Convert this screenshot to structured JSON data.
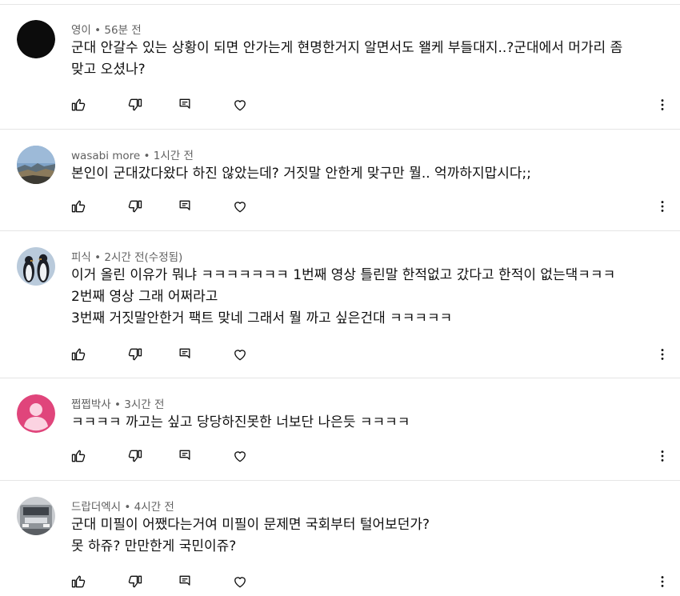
{
  "comments": [
    {
      "author": "영이",
      "time": "56분 전",
      "lines": [
        "군대 안갈수 있는 상황이 되면 안가는게 현명한거지 알면서도 왤케 부들대지..?군대에서 머가리 좀",
        "맞고 오셨나?"
      ],
      "avatar": "black-circle"
    },
    {
      "author": "wasabi more",
      "time": "1시간 전",
      "lines": [
        "본인이 군대갔다왔다 하진 않았는데? 거짓말 안한게 맞구만 뭘.. 억까하지맙시다;;"
      ],
      "avatar": "landscape-photo"
    },
    {
      "author": "피식",
      "time": "2시간 전(수정됨)",
      "lines": [
        "이거 올린 이유가 뭐냐 ㅋㅋㅋㅋㅋㅋㅋ 1번째 영상 틀린말 한적없고 갔다고 한적이 없는댁ㅋㅋㅋ",
        "2번째 영상 그래 어쩌라고",
        "3번째 거짓말안한거 팩트 맞네 그래서 뭘 까고 싶은건대 ㅋㅋㅋㅋㅋ"
      ],
      "avatar": "penguin-photo"
    },
    {
      "author": "쩝쩝박사",
      "time": "3시간 전",
      "lines": [
        "ㅋㅋㅋㅋ 까고는 싶고 당당하진못한 너보단 나은듯 ㅋㅋㅋㅋ"
      ],
      "avatar": "default-person-pink"
    },
    {
      "author": "드랍더엑시",
      "time": "4시간 전",
      "lines": [
        "군대 미필이 어쨌다는거여 미필이 문제면 국회부터 털어보던가?",
        "못 하쥬? 만만한게 국민이쥬?"
      ],
      "avatar": "truck-photo"
    }
  ],
  "icons": {
    "like": "thumb-up-icon",
    "dislike": "thumb-down-icon",
    "reply": "reply-icon",
    "heart": "heart-icon",
    "more": "more-vert-icon"
  },
  "colors": {
    "meta": "#606060",
    "divider": "#e5e5e5",
    "avatar_pink": "#e0457b"
  }
}
